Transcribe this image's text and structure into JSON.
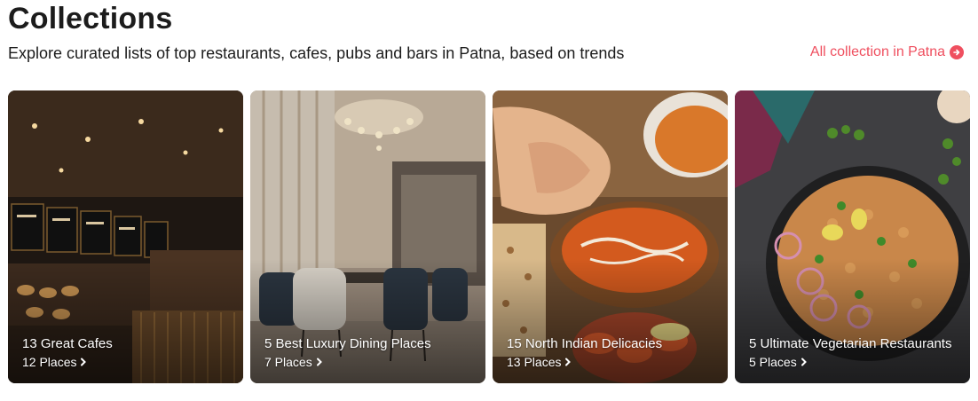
{
  "header": {
    "title": "Collections",
    "subtitle": "Explore curated lists of top restaurants, cafes, pubs and bars in Patna, based on trends",
    "all_link_label": "All collection in Patna",
    "all_link_icon": "arrow-right-circle-icon"
  },
  "collections": [
    {
      "title": "13 Great Cafes",
      "places": "12 Places",
      "scene": "cafe-counter"
    },
    {
      "title": "5 Best Luxury Dining Places",
      "places": "7 Places",
      "scene": "luxury-dining-room"
    },
    {
      "title": "15 North Indian Delicacies",
      "places": "13 Places",
      "scene": "curry-and-naan"
    },
    {
      "title": "5 Ultimate Vegetarian Restaurants",
      "places": "5 Places",
      "scene": "veg-pulao-bowl"
    }
  ],
  "colors": {
    "accent": "#ef4f5f",
    "text": "#1c1c1c"
  }
}
